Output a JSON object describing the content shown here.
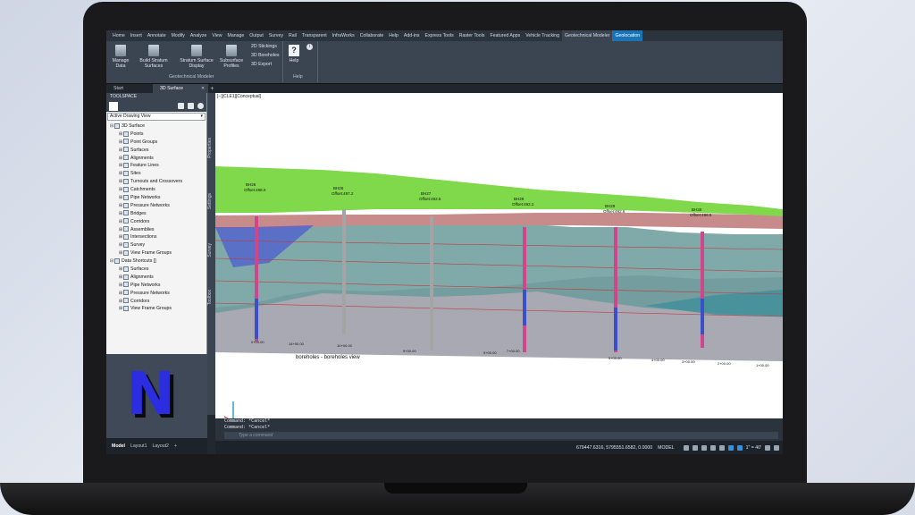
{
  "ribbon": {
    "tabs": [
      "Home",
      "Insert",
      "Annotate",
      "Modify",
      "Analyze",
      "View",
      "Manage",
      "Output",
      "Survey",
      "Rail",
      "Transparent",
      "InfraWorks",
      "Collaborate",
      "Help",
      "Add-ins",
      "Express Tools",
      "Raster Tools",
      "Featured Apps",
      "Vehicle Tracking",
      "Geotechnical Modeler",
      "Geolocation"
    ],
    "active_tab": "Geotechnical Modeler",
    "buttons": {
      "manage_data": "Manage Data",
      "build_stratum": "Build Stratum Surfaces",
      "stratum_display": "Stratum Surface Display",
      "subsurface_profiles": "Subsurface Profiles",
      "stickings": "2D Stickings",
      "boreholes": "3D Boreholes",
      "export": "3D Export",
      "help": "Help"
    },
    "panel_label": "Geotechnical Modeler",
    "help_panel_label": "Help"
  },
  "doc_tabs": [
    {
      "label": "Start"
    },
    {
      "label": "3D Surface"
    }
  ],
  "toolspace": {
    "title": "TOOLSPACE",
    "view_select": "Active Drawing View",
    "tree": [
      {
        "label": "3D Surface",
        "level": 0
      },
      {
        "label": "Points",
        "level": 1
      },
      {
        "label": "Point Groups",
        "level": 1
      },
      {
        "label": "Surfaces",
        "level": 1
      },
      {
        "label": "Alignments",
        "level": 1
      },
      {
        "label": "Feature Lines",
        "level": 1
      },
      {
        "label": "Sites",
        "level": 1
      },
      {
        "label": "Turnouts and Crossovers",
        "level": 1
      },
      {
        "label": "Catchments",
        "level": 1
      },
      {
        "label": "Pipe Networks",
        "level": 1
      },
      {
        "label": "Pressure Networks",
        "level": 1
      },
      {
        "label": "Bridges",
        "level": 1
      },
      {
        "label": "Corridors",
        "level": 1
      },
      {
        "label": "Assemblies",
        "level": 1
      },
      {
        "label": "Intersections",
        "level": 1
      },
      {
        "label": "Survey",
        "level": 1
      },
      {
        "label": "View Frame Groups",
        "level": 1
      },
      {
        "label": "Data Shortcuts []",
        "level": 0
      },
      {
        "label": "Surfaces",
        "level": 1
      },
      {
        "label": "Alignments",
        "level": 1
      },
      {
        "label": "Pipe Networks",
        "level": 1
      },
      {
        "label": "Pressure Networks",
        "level": 1
      },
      {
        "label": "Corridors",
        "level": 1
      },
      {
        "label": "View Frame Groups",
        "level": 1
      }
    ],
    "side_tabs": [
      "Properties",
      "Settings",
      "Survey",
      "Toolbox"
    ]
  },
  "viewport": {
    "label": "[−][CLE1][Conceptual]",
    "title": "boreholes - boreholes view",
    "boreholes": [
      {
        "name": "BH26",
        "offset": "Offset:498.0"
      },
      {
        "name": "BH26",
        "offset": "Offset:497.2"
      },
      {
        "name": "BH27",
        "offset": "Offset:492.5"
      },
      {
        "name": "BH28",
        "offset": "Offset:492.2"
      },
      {
        "name": "BH29",
        "offset": "Offset:492.6"
      },
      {
        "name": "BH30",
        "offset": "Offset:498.5"
      }
    ],
    "stations": [
      "0+00.00",
      "14+00.00",
      "10+00.00",
      "9+00.00",
      "9+00.00",
      "7+00.00",
      "5+00.00",
      "4+00.00",
      "3+00.00",
      "2+00.00",
      "1+00.00"
    ]
  },
  "command": {
    "history": [
      "Command: *Cancel*",
      "Command: *Cancel*"
    ],
    "placeholder": "Type a command"
  },
  "layout_tabs": [
    "Model",
    "Layout1",
    "Layout2"
  ],
  "status": {
    "coords": "679447.6316, 5795551.6582, 0.0000",
    "mode": "MODEL",
    "scale": "1\" = 40'"
  },
  "logo_letter": "N"
}
